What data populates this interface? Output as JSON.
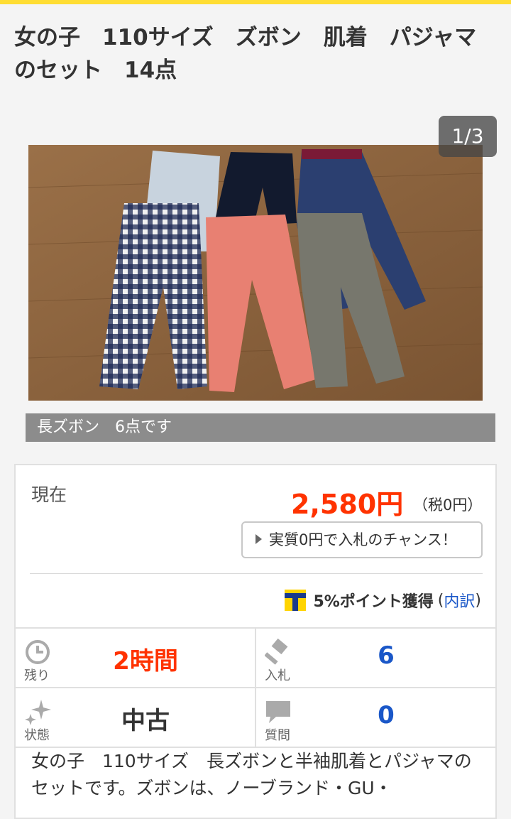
{
  "title": "女の子　110サイズ　ズボン　肌着　パジャマのセット　14点",
  "gallery": {
    "counter": "1/3",
    "caption": "長ズボン　6点です"
  },
  "price": {
    "label": "現在",
    "amount": "2,580円",
    "tax": "（税0円）",
    "chance_button": "実質0円で入札のチャンス！"
  },
  "points": {
    "rate": "5%ポイント獲得",
    "open": "(",
    "link": "内訳",
    "close": ")"
  },
  "stats": {
    "remaining": {
      "label": "残り",
      "value": "2時間",
      "icon": "clock-icon"
    },
    "bids": {
      "label": "入札",
      "value": "6",
      "icon": "gavel-icon"
    },
    "condition": {
      "label": "状態",
      "value": "中古",
      "icon": "sparkle-icon"
    },
    "questions": {
      "label": "質問",
      "value": "0",
      "icon": "speech-bubble-icon"
    }
  },
  "description": "女の子　110サイズ　長ズボンと半袖肌着とパジャマのセットです。ズボンは、ノーブランド・GU・",
  "colors": {
    "accent_yellow": "#ffdd33",
    "price_red": "#ff3300",
    "link_blue": "#1a57c8"
  }
}
